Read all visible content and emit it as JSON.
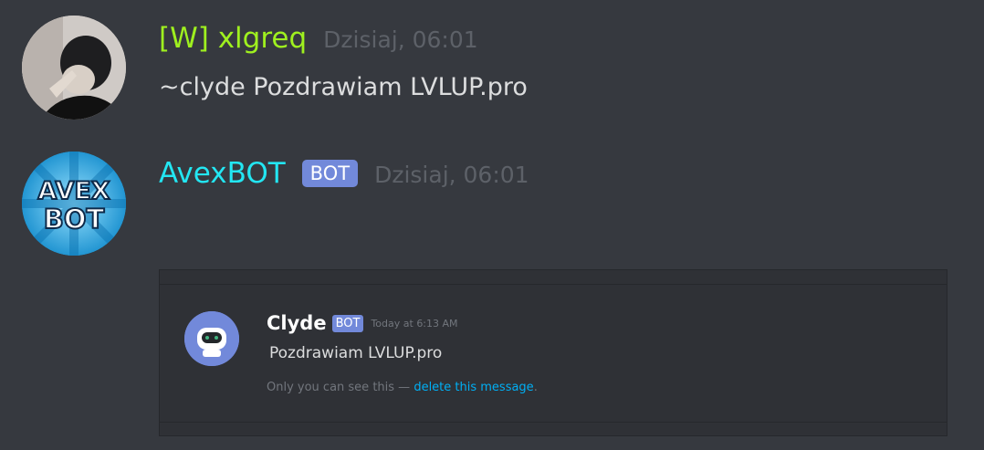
{
  "messages": [
    {
      "username": "[W] xlgreq",
      "username_color": "#9ff01f",
      "timestamp": "Dzisiaj, 06:01",
      "content": "~clyde Pozdrawiam LVLUP.pro"
    },
    {
      "username": "AvexBOT",
      "username_color": "#23e6f2",
      "badge": "BOT",
      "timestamp": "Dzisiaj, 06:01",
      "avatar_text_line1": "AVEX",
      "avatar_text_line2": "BOT"
    }
  ],
  "embed": {
    "author": "Clyde",
    "badge": "BOT",
    "timestamp": "Today at 6:13 AM",
    "text": "Pozdrawiam LVLUP.pro",
    "note_prefix": "Only you can see this — ",
    "note_link": "delete this message",
    "note_suffix": "."
  },
  "colors": {
    "background": "#36393f",
    "embed_background": "#2f3136",
    "badge": "#7289da",
    "link": "#00aff4"
  }
}
